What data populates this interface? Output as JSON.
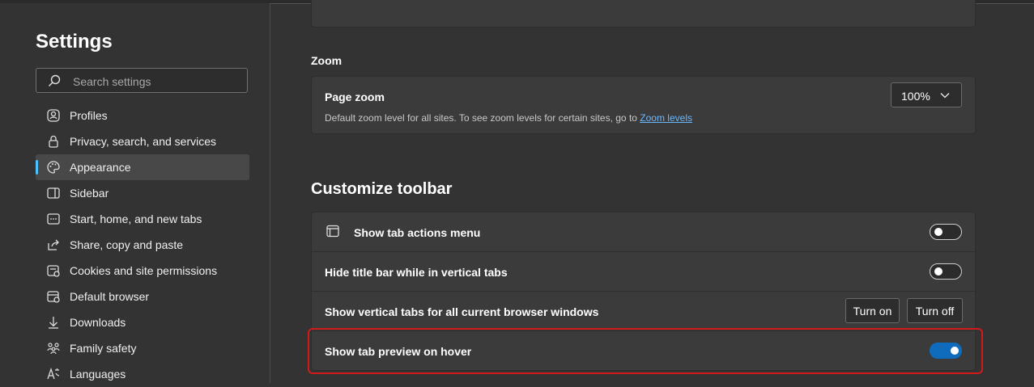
{
  "sidebar": {
    "title": "Settings",
    "search_placeholder": "Search settings",
    "items": [
      {
        "label": "Profiles",
        "icon": "profile-icon"
      },
      {
        "label": "Privacy, search, and services",
        "icon": "lock-icon"
      },
      {
        "label": "Appearance",
        "icon": "palette-icon",
        "active": true
      },
      {
        "label": "Sidebar",
        "icon": "sidebar-icon"
      },
      {
        "label": "Start, home, and new tabs",
        "icon": "home-tabs-icon"
      },
      {
        "label": "Share, copy and paste",
        "icon": "share-icon"
      },
      {
        "label": "Cookies and site permissions",
        "icon": "cookies-icon"
      },
      {
        "label": "Default browser",
        "icon": "browser-icon"
      },
      {
        "label": "Downloads",
        "icon": "download-icon"
      },
      {
        "label": "Family safety",
        "icon": "family-icon"
      },
      {
        "label": "Languages",
        "icon": "languages-icon"
      }
    ]
  },
  "zoom": {
    "section_label": "Zoom",
    "page_zoom_title": "Page zoom",
    "page_zoom_desc": "Default zoom level for all sites. To see zoom levels for certain sites, go to",
    "zoom_levels_link": "Zoom levels",
    "zoom_value": "100%"
  },
  "toolbar": {
    "section_title": "Customize toolbar",
    "rows": {
      "tab_actions": {
        "label": "Show tab actions menu",
        "on": false
      },
      "hide_title": {
        "label": "Hide title bar while in vertical tabs",
        "on": false
      },
      "vertical_tabs": {
        "label": "Show vertical tabs for all current browser windows",
        "turn_on": "Turn on",
        "turn_off": "Turn off"
      },
      "tab_preview": {
        "label": "Show tab preview on hover",
        "on": true
      }
    }
  },
  "colors": {
    "accent": "#0f6cbd",
    "highlight": "#d11a1a",
    "link": "#6cb8ff"
  }
}
